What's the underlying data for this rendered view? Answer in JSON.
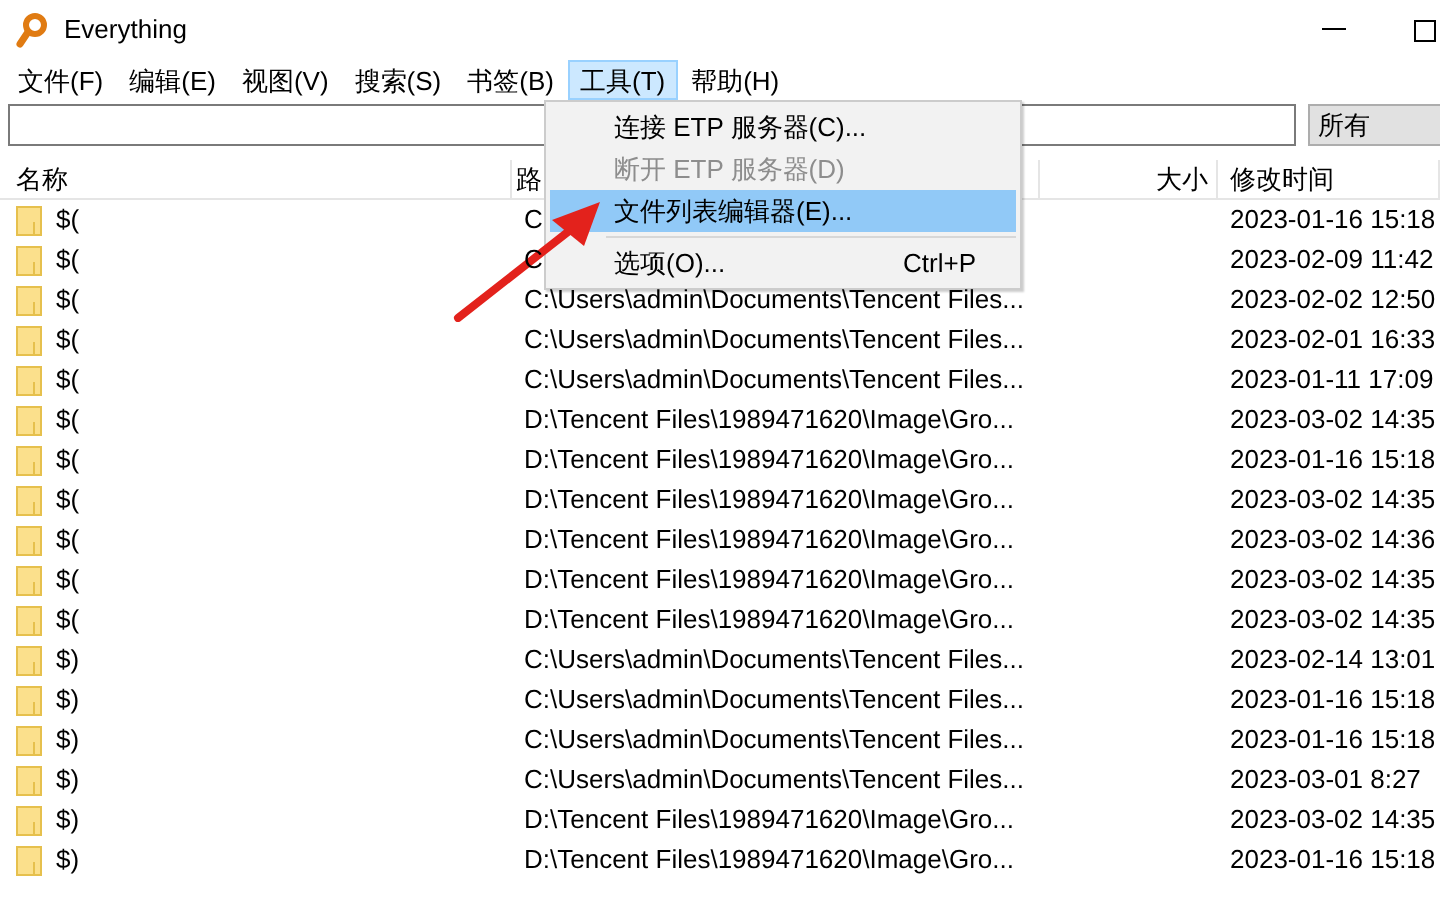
{
  "window": {
    "title": "Everything"
  },
  "menu_bar": [
    {
      "label": "文件(F)",
      "selected": false
    },
    {
      "label": "编辑(E)",
      "selected": false
    },
    {
      "label": "视图(V)",
      "selected": false
    },
    {
      "label": "搜索(S)",
      "selected": false
    },
    {
      "label": "书签(B)",
      "selected": false
    },
    {
      "label": "工具(T)",
      "selected": true
    },
    {
      "label": "帮助(H)",
      "selected": false
    }
  ],
  "search": {
    "filter": "所有"
  },
  "table": {
    "columns": [
      "名称",
      "路",
      "大小",
      "修改时间"
    ],
    "rows": [
      {
        "name": "$(",
        "path": "C",
        "modified": "2023-01-16 15:18"
      },
      {
        "name": "$(",
        "path": "C",
        "modified": "2023-02-09 11:42"
      },
      {
        "name": "$(",
        "path": "C:\\Users\\admin\\Documents\\Tencent Files...",
        "modified": "2023-02-02 12:50"
      },
      {
        "name": "$(",
        "path": "C:\\Users\\admin\\Documents\\Tencent Files...",
        "modified": "2023-02-01 16:33"
      },
      {
        "name": "$(",
        "path": "C:\\Users\\admin\\Documents\\Tencent Files...",
        "modified": "2023-01-11 17:09"
      },
      {
        "name": "$(",
        "path": "D:\\Tencent Files\\1989471620\\Image\\Gro...",
        "modified": "2023-03-02 14:35"
      },
      {
        "name": "$(",
        "path": "D:\\Tencent Files\\1989471620\\Image\\Gro...",
        "modified": "2023-01-16 15:18"
      },
      {
        "name": "$(",
        "path": "D:\\Tencent Files\\1989471620\\Image\\Gro...",
        "modified": "2023-03-02 14:35"
      },
      {
        "name": "$(",
        "path": "D:\\Tencent Files\\1989471620\\Image\\Gro...",
        "modified": "2023-03-02 14:36"
      },
      {
        "name": "$(",
        "path": "D:\\Tencent Files\\1989471620\\Image\\Gro...",
        "modified": "2023-03-02 14:35"
      },
      {
        "name": "$(",
        "path": "D:\\Tencent Files\\1989471620\\Image\\Gro...",
        "modified": "2023-03-02 14:35"
      },
      {
        "name": "$)",
        "path": "C:\\Users\\admin\\Documents\\Tencent Files...",
        "modified": "2023-02-14 13:01"
      },
      {
        "name": "$)",
        "path": "C:\\Users\\admin\\Documents\\Tencent Files...",
        "modified": "2023-01-16 15:18"
      },
      {
        "name": "$)",
        "path": "C:\\Users\\admin\\Documents\\Tencent Files...",
        "modified": "2023-01-16 15:18"
      },
      {
        "name": "$)",
        "path": "C:\\Users\\admin\\Documents\\Tencent Files...",
        "modified": "2023-03-01 8:27"
      },
      {
        "name": "$)",
        "path": "D:\\Tencent Files\\1989471620\\Image\\Gro...",
        "modified": "2023-03-02 14:35"
      },
      {
        "name": "$)",
        "path": "D:\\Tencent Files\\1989471620\\Image\\Gro...",
        "modified": "2023-01-16 15:18"
      }
    ]
  },
  "dropdown_menu": [
    {
      "label": "连接 ETP 服务器(C)...",
      "disabled": false,
      "selected": false
    },
    {
      "label": "断开 ETP 服务器(D)",
      "disabled": true,
      "selected": false
    },
    {
      "label": "文件列表编辑器(E)...",
      "disabled": false,
      "selected": true
    },
    {
      "kind": "separator"
    },
    {
      "label": "选项(O)...",
      "shortcut": "Ctrl+P",
      "disabled": false,
      "selected": false
    }
  ]
}
